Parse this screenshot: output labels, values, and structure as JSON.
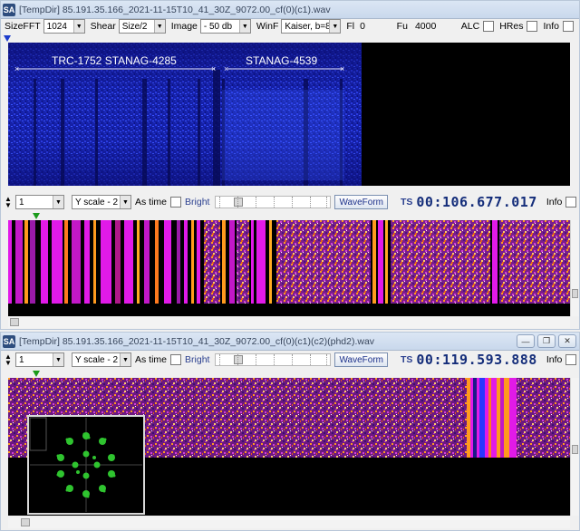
{
  "window1": {
    "title": "[TempDir] 85.191.35.166_2021-11-15T10_41_30Z_9072.00_cf(0)(c1).wav",
    "toolbar": {
      "sizefft_label": "SizeFFT",
      "sizefft_value": "1024",
      "shear_label": "Shear",
      "shear_value": "Size/2",
      "image_label": "Image",
      "image_value": "- 50 db",
      "winf_label": "WinF",
      "winf_value": "Kaiser, b=8",
      "fl_label": "Fl",
      "fl_value": "0",
      "fu_label": "Fu",
      "fu_value": "4000",
      "alc_label": "ALC",
      "hres_label": "HRes",
      "info_label": "Info"
    },
    "annotations": {
      "left_label": "TRC-1752 STANAG-4285",
      "right_label": "STANAG-4539"
    },
    "controls": {
      "spin_value": "1",
      "yscale_value": "Y scale - 2",
      "as_time_label": "As time",
      "bright_label": "Bright",
      "waveform_label": "WaveForm",
      "ts_label": "TS",
      "ts_value": "00:106.677.017",
      "info_label": "Info"
    }
  },
  "window2": {
    "title": "[TempDir] 85.191.35.166_2021-11-15T10_41_30Z_9072.00_cf(0)(c1)(c2)(phd2).wav",
    "controls": {
      "spin_value": "1",
      "yscale_value": "Y scale - 2",
      "as_time_label": "As time",
      "bright_label": "Bright",
      "waveform_label": "WaveForm",
      "ts_label": "TS",
      "ts_value": "00:119.593.888",
      "info_label": "Info"
    }
  },
  "colors": {
    "spectrogram_bg": "#0a0c6e",
    "plot_bg": "#000000",
    "ts_text": "#142d7a",
    "constellation_points": "#2fc42f"
  },
  "icons": [
    "app-icon",
    "minimize-icon",
    "restore-icon",
    "close-icon",
    "playhead-marker-icon"
  ]
}
